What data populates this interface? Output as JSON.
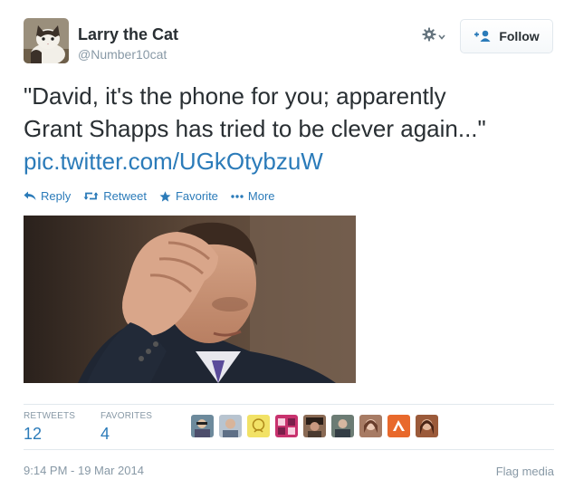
{
  "author": {
    "display_name": "Larry the Cat",
    "handle": "@Number10cat",
    "avatar_icon": "cat-avatar"
  },
  "follow_button": {
    "label": "Follow",
    "icon": "add-user-icon"
  },
  "settings_icon": "gear-icon",
  "tweet": {
    "text_line_1": "\"David, it's the phone for you; apparently",
    "text_line_2": "Grant Shapps has tried to be clever again...\"",
    "link_text": "pic.twitter.com/UGkOtybzuW"
  },
  "actions": {
    "reply": "Reply",
    "retweet": "Retweet",
    "favorite": "Favorite",
    "more": "More"
  },
  "media": {
    "description": "photo"
  },
  "stats": {
    "retweets_label": "RETWEETS",
    "retweets_count": "12",
    "favorites_label": "FAVORITES",
    "favorites_count": "4"
  },
  "timestamp": "9:14 PM - 19 Mar 2014",
  "flag_media": "Flag media",
  "colors": {
    "link": "#2b7bb9",
    "muted": "#8899a6",
    "text": "#292f33"
  }
}
